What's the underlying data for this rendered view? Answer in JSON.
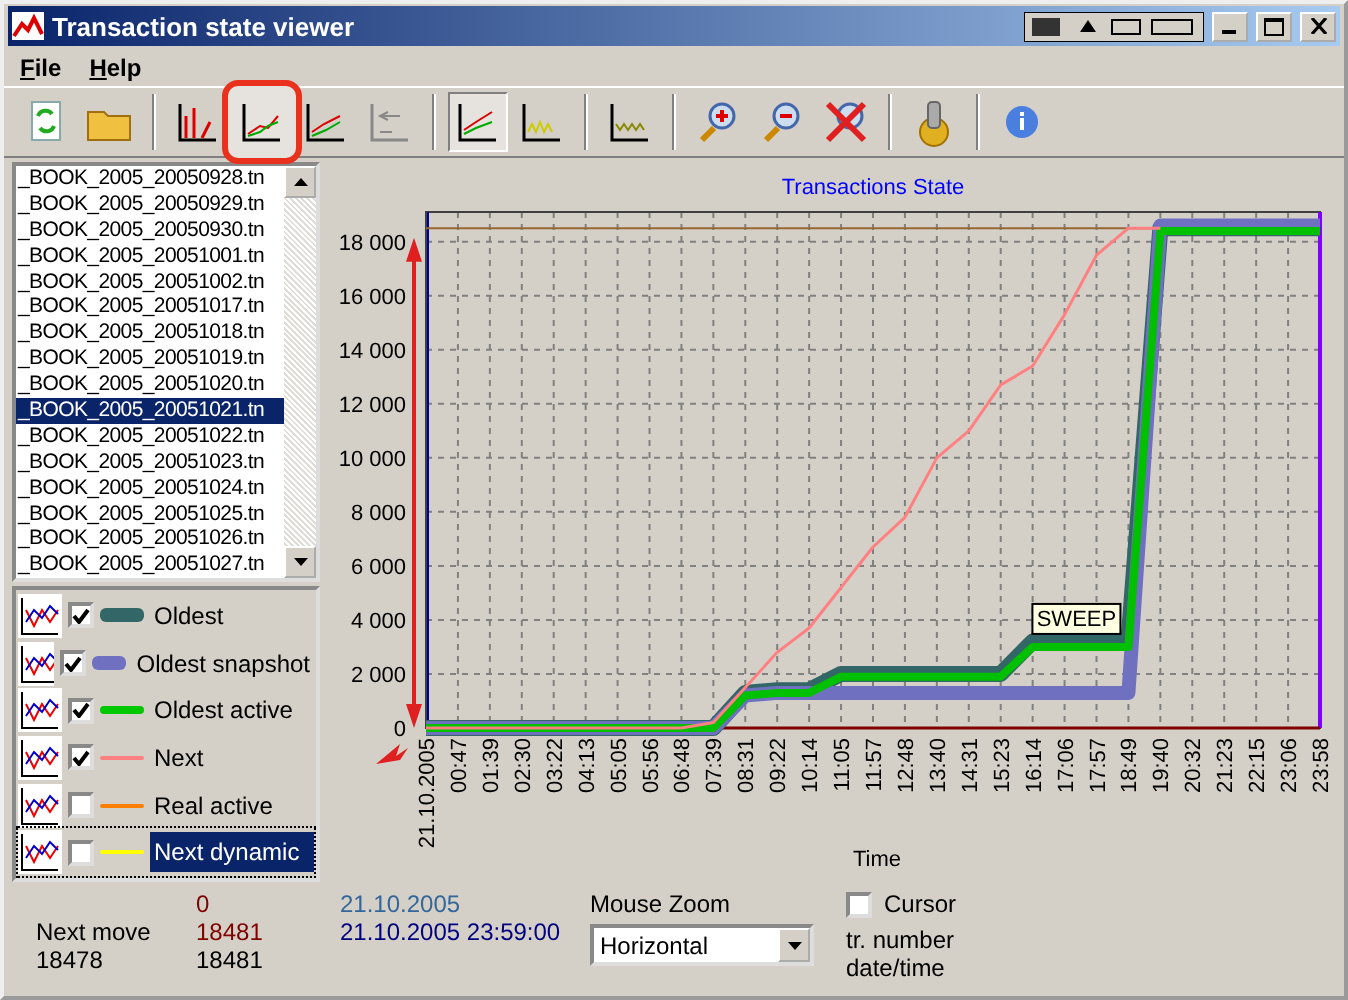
{
  "window": {
    "title": "Transaction state viewer"
  },
  "menu": [
    {
      "label": "File"
    },
    {
      "label": "Help"
    }
  ],
  "toolbar": [
    {
      "kind": "refresh",
      "pressed": false,
      "highlighted": false
    },
    {
      "kind": "open",
      "pressed": false,
      "highlighted": false
    },
    {
      "kind": "sep"
    },
    {
      "kind": "bars",
      "pressed": false,
      "highlighted": false
    },
    {
      "kind": "lines",
      "pressed": true,
      "highlighted": true
    },
    {
      "kind": "lines2",
      "pressed": false,
      "highlighted": false
    },
    {
      "kind": "steps",
      "pressed": false,
      "highlighted": false
    },
    {
      "kind": "sep"
    },
    {
      "kind": "lines3",
      "pressed": true,
      "highlighted": false
    },
    {
      "kind": "yellow",
      "pressed": false,
      "highlighted": false
    },
    {
      "kind": "sep"
    },
    {
      "kind": "olive",
      "pressed": false,
      "highlighted": false
    },
    {
      "kind": "sep"
    },
    {
      "kind": "zoomin",
      "pressed": false,
      "highlighted": false
    },
    {
      "kind": "zoomout",
      "pressed": false,
      "highlighted": false
    },
    {
      "kind": "zoomreset",
      "pressed": false,
      "highlighted": false
    },
    {
      "kind": "sep"
    },
    {
      "kind": "settings",
      "pressed": false,
      "highlighted": false
    },
    {
      "kind": "sep"
    },
    {
      "kind": "info",
      "pressed": false,
      "highlighted": false
    }
  ],
  "files": [
    {
      "name": "_BOOK_2005_20050928.tn",
      "selected": false
    },
    {
      "name": "_BOOK_2005_20050929.tn",
      "selected": false
    },
    {
      "name": "_BOOK_2005_20050930.tn",
      "selected": false
    },
    {
      "name": "_BOOK_2005_20051001.tn",
      "selected": false
    },
    {
      "name": "_BOOK_2005_20051002.tn",
      "selected": false
    },
    {
      "name": "_BOOK_2005_20051017.tn",
      "selected": false
    },
    {
      "name": "_BOOK_2005_20051018.tn",
      "selected": false
    },
    {
      "name": "_BOOK_2005_20051019.tn",
      "selected": false
    },
    {
      "name": "_BOOK_2005_20051020.tn",
      "selected": false
    },
    {
      "name": "_BOOK_2005_20051021.tn",
      "selected": true
    },
    {
      "name": "_BOOK_2005_20051022.tn",
      "selected": false
    },
    {
      "name": "_BOOK_2005_20051023.tn",
      "selected": false
    },
    {
      "name": "_BOOK_2005_20051024.tn",
      "selected": false
    },
    {
      "name": "_BOOK_2005_20051025.tn",
      "selected": false
    },
    {
      "name": "_BOOK_2005_20051026.tn",
      "selected": false
    },
    {
      "name": "_BOOK_2005_20051027.tn",
      "selected": false
    }
  ],
  "legend": [
    {
      "label": "Oldest",
      "checked": true,
      "color": "#336666",
      "kind": "thick",
      "selected": false
    },
    {
      "label": "Oldest snapshot",
      "checked": true,
      "color": "#7070c0",
      "kind": "thick",
      "selected": false
    },
    {
      "label": "Oldest active",
      "checked": true,
      "color": "#00c800",
      "kind": "medium",
      "selected": false
    },
    {
      "label": "Next",
      "checked": true,
      "color": "#ff8080",
      "kind": "thin",
      "selected": false
    },
    {
      "label": "Real active",
      "checked": false,
      "color": "#ff8000",
      "kind": "thin",
      "selected": false
    },
    {
      "label": "Next dynamic",
      "checked": false,
      "color": "#ffff00",
      "kind": "thin",
      "selected": true
    }
  ],
  "chart": {
    "chart_data": {
      "type": "line",
      "title": "Transactions State",
      "xlabel": "Time",
      "categories": [
        "21.10.2005",
        "00:47",
        "01:39",
        "02:30",
        "03:22",
        "04:13",
        "05:05",
        "05:56",
        "06:48",
        "07:39",
        "08:31",
        "09:22",
        "10:14",
        "11:05",
        "11:57",
        "12:48",
        "13:40",
        "14:31",
        "15:23",
        "16:14",
        "17:06",
        "17:57",
        "18:49",
        "19:40",
        "20:32",
        "21:23",
        "22:15",
        "23:06",
        "23:58"
      ],
      "series": [
        {
          "color": "#996633",
          "values": [
            18500,
            18500,
            18500,
            18500,
            18500,
            18500,
            18500,
            18500,
            18500,
            18500,
            18500,
            18500,
            18500,
            18500,
            18500,
            18500,
            18500,
            18500,
            18500,
            18500,
            18500,
            18500,
            18500,
            18500,
            null,
            null,
            null,
            null,
            null
          ]
        },
        {
          "color": "#336666",
          "values": [
            0,
            0,
            0,
            0,
            0,
            0,
            0,
            0,
            0,
            0,
            1300,
            1400,
            1400,
            2000,
            2000,
            2000,
            2000,
            2000,
            2000,
            3200,
            3200,
            3200,
            3200,
            18500,
            18500,
            18500,
            18500,
            18500,
            18500
          ]
        },
        {
          "color": "#7070c0",
          "values": [
            0,
            0,
            0,
            0,
            0,
            0,
            0,
            0,
            0,
            0,
            1200,
            1300,
            1300,
            1300,
            1300,
            1300,
            1300,
            1300,
            1300,
            1300,
            1300,
            1300,
            1300,
            18600,
            18600,
            18600,
            18600,
            18600,
            18600
          ]
        },
        {
          "color": "#00c000",
          "values": [
            0,
            0,
            0,
            0,
            0,
            0,
            0,
            0,
            0,
            0,
            1200,
            1300,
            1300,
            1900,
            1900,
            1900,
            1900,
            1900,
            1900,
            3000,
            3000,
            3000,
            3000,
            18400,
            18400,
            18400,
            18400,
            18400,
            18400
          ]
        },
        {
          "color": "#ff8080",
          "values": [
            0,
            0,
            0,
            0,
            0,
            0,
            0,
            0,
            0,
            200,
            1500,
            2800,
            3700,
            5200,
            6700,
            7800,
            10000,
            11000,
            12700,
            13400,
            15300,
            17500,
            18500,
            18500,
            null,
            null,
            null,
            null,
            null
          ]
        }
      ],
      "ylim": [
        0,
        19100
      ],
      "yticks": [
        {
          "value": 0,
          "label": "0"
        },
        {
          "value": 2000,
          "label": "2 000"
        },
        {
          "value": 4000,
          "label": "4 000"
        },
        {
          "value": 6000,
          "label": "6 000"
        },
        {
          "value": 8000,
          "label": "8 000"
        },
        {
          "value": 10000,
          "label": "10 000"
        },
        {
          "value": 12000,
          "label": "12 000"
        },
        {
          "value": 14000,
          "label": "14 000"
        },
        {
          "value": 16000,
          "label": "16 000"
        },
        {
          "value": 18000,
          "label": "18 000"
        }
      ],
      "grid": true,
      "annotations": [
        {
          "text": "SWEEP",
          "x": "18:49",
          "y": 4000
        }
      ]
    }
  },
  "status": {
    "next_move_label": "Next move",
    "next_move": "18478",
    "values": [
      {
        "text": "0",
        "color": "#800000"
      },
      {
        "text": "18481",
        "color": "#800000"
      },
      {
        "text": "18481",
        "color": "#000000"
      }
    ],
    "dates": [
      {
        "text": "21.10.2005",
        "color": "#336699"
      },
      {
        "text": "21.10.2005 23:59:00",
        "color": "#000080"
      }
    ],
    "zoom_label": "Mouse Zoom",
    "zoom_value": "Horizontal",
    "cursor": {
      "label": "Cursor",
      "checked": false
    },
    "notes": [
      "tr. number",
      "date/time"
    ]
  }
}
